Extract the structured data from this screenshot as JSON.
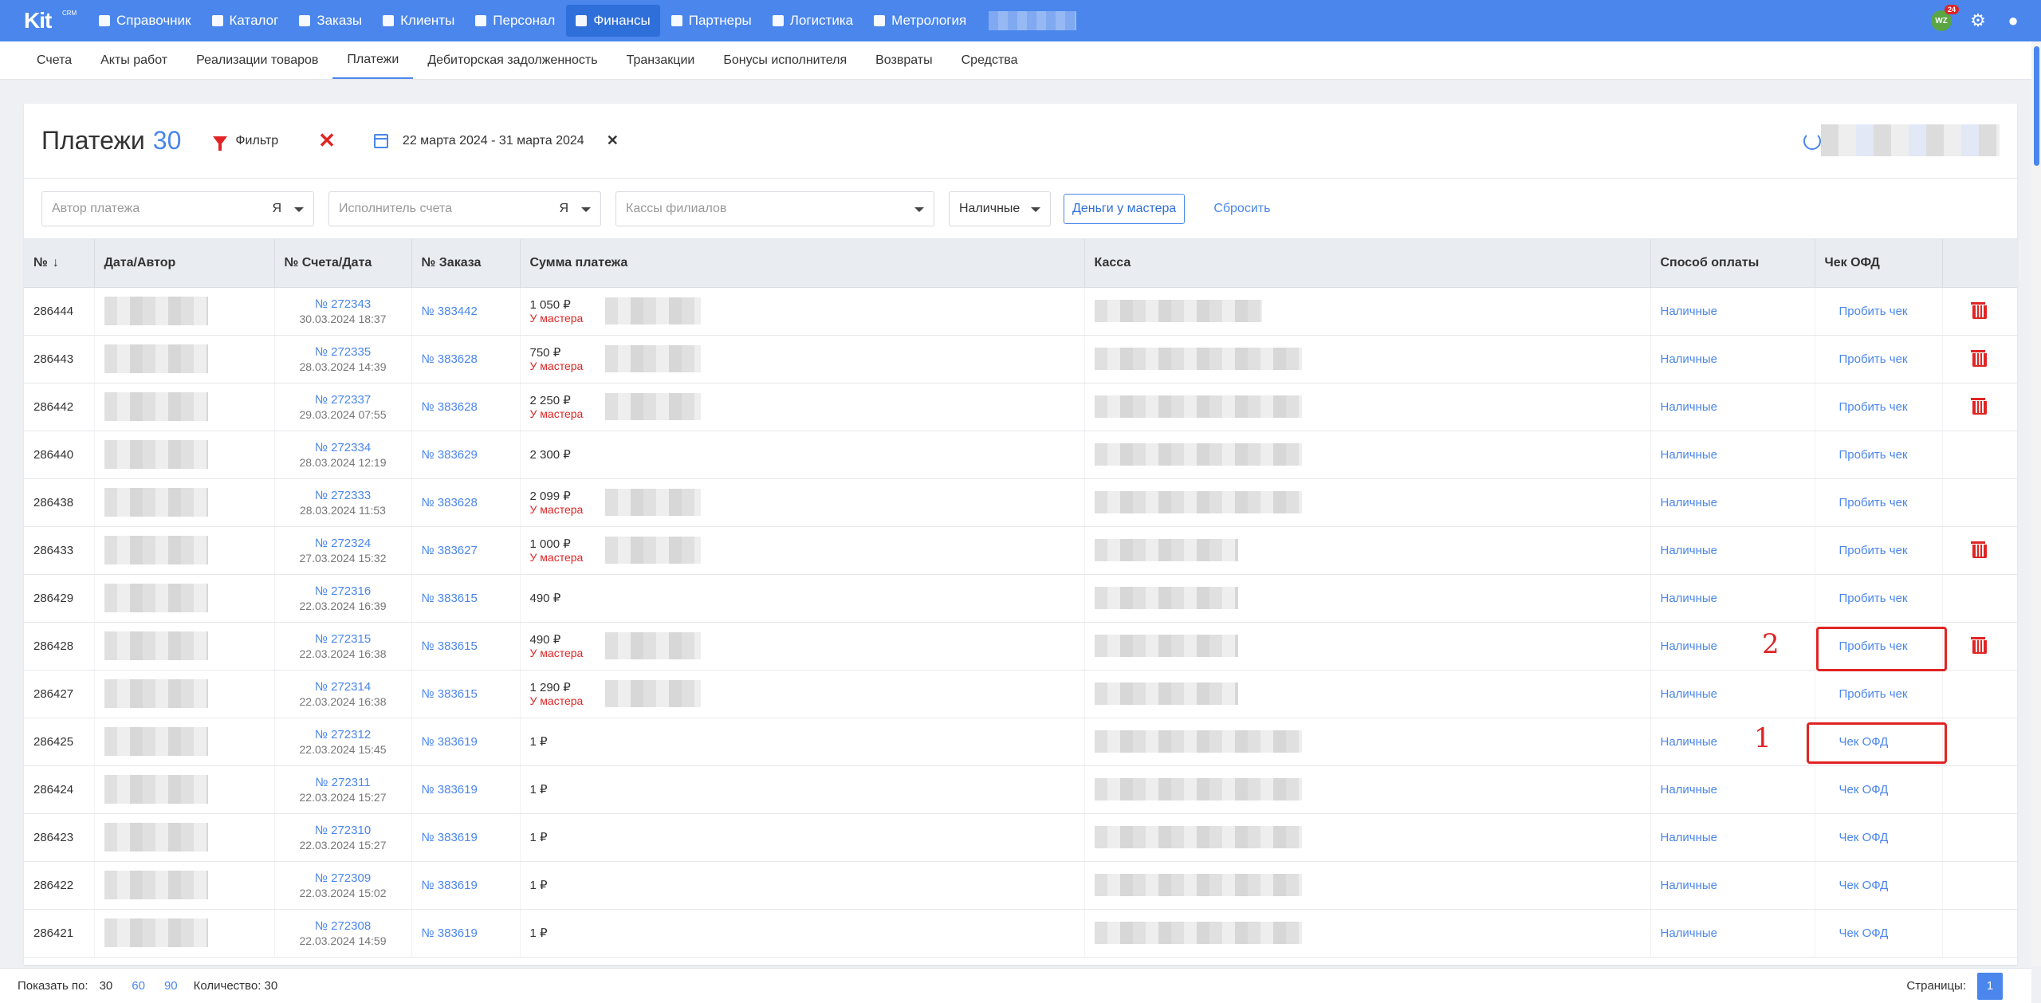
{
  "app": {
    "logo": "Kit",
    "logo_sup": "CRM"
  },
  "topnav": [
    {
      "label": "Справочник",
      "icon": "book-icon"
    },
    {
      "label": "Каталог",
      "icon": "catalog-icon"
    },
    {
      "label": "Заказы",
      "icon": "orders-icon"
    },
    {
      "label": "Клиенты",
      "icon": "clients-icon"
    },
    {
      "label": "Персонал",
      "icon": "staff-icon"
    },
    {
      "label": "Финансы",
      "icon": "finance-icon",
      "active": true
    },
    {
      "label": "Партнеры",
      "icon": "partners-icon"
    },
    {
      "label": "Логистика",
      "icon": "truck-icon"
    },
    {
      "label": "Метрология",
      "icon": "metrology-icon"
    }
  ],
  "user": {
    "initials": "WZ",
    "notifications": "24"
  },
  "subnav": [
    "Счета",
    "Акты работ",
    "Реализации товаров",
    "Платежи",
    "Дебиторская задолженность",
    "Транзакции",
    "Бонусы исполнителя",
    "Возвраты",
    "Средства"
  ],
  "subnav_active": "Платежи",
  "header": {
    "title": "Платежи",
    "count": "30",
    "filter_label": "Фильтр",
    "date_range": "22 марта 2024 - 31 марта 2024"
  },
  "filters": {
    "author_placeholder": "Автор платежа",
    "author_value": "Я",
    "executor_placeholder": "Исполнитель счета",
    "executor_value": "Я",
    "cash_placeholder": "Кассы филиалов",
    "payment_type": "Наличные",
    "master_money_btn": "Деньги у мастера",
    "reset": "Сбросить"
  },
  "table": {
    "columns": [
      "№",
      "Дата/Автор",
      "№ Счета/Дата",
      "№ Заказа",
      "Сумма платежа",
      "Касса",
      "Способ оплаты",
      "Чек ОФД",
      ""
    ],
    "rows": [
      {
        "id": "286444",
        "account": "№ 272343",
        "account_date": "30.03.2024 18:37",
        "order": "№ 383442",
        "amount": "1 050 ₽",
        "sub": "У мастера",
        "method": "Наличные",
        "ofd": "Пробить чек",
        "trash": true
      },
      {
        "id": "286443",
        "account": "№ 272335",
        "account_date": "28.03.2024 14:39",
        "order": "№ 383628",
        "amount": "750 ₽",
        "sub": "У мастера",
        "method": "Наличные",
        "ofd": "Пробить чек",
        "trash": true
      },
      {
        "id": "286442",
        "account": "№ 272337",
        "account_date": "29.03.2024 07:55",
        "order": "№ 383628",
        "amount": "2 250 ₽",
        "sub": "У мастера",
        "method": "Наличные",
        "ofd": "Пробить чек",
        "trash": true
      },
      {
        "id": "286440",
        "account": "№ 272334",
        "account_date": "28.03.2024 12:19",
        "order": "№ 383629",
        "amount": "2 300 ₽",
        "sub": "",
        "method": "Наличные",
        "ofd": "Пробить чек",
        "trash": false
      },
      {
        "id": "286438",
        "account": "№ 272333",
        "account_date": "28.03.2024 11:53",
        "order": "№ 383628",
        "amount": "2 099 ₽",
        "sub": "У мастера",
        "method": "Наличные",
        "ofd": "Пробить чек",
        "trash": false
      },
      {
        "id": "286433",
        "account": "№ 272324",
        "account_date": "27.03.2024 15:32",
        "order": "№ 383627",
        "amount": "1 000 ₽",
        "sub": "У мастера",
        "method": "Наличные",
        "ofd": "Пробить чек",
        "trash": true
      },
      {
        "id": "286429",
        "account": "№ 272316",
        "account_date": "22.03.2024 16:39",
        "order": "№ 383615",
        "amount": "490 ₽",
        "sub": "",
        "method": "Наличные",
        "ofd": "Пробить чек",
        "trash": false
      },
      {
        "id": "286428",
        "account": "№ 272315",
        "account_date": "22.03.2024 16:38",
        "order": "№ 383615",
        "amount": "490 ₽",
        "sub": "У мастера",
        "method": "Наличные",
        "ofd": "Пробить чек",
        "trash": true
      },
      {
        "id": "286427",
        "account": "№ 272314",
        "account_date": "22.03.2024 16:38",
        "order": "№ 383615",
        "amount": "1 290 ₽",
        "sub": "У мастера",
        "method": "Наличные",
        "ofd": "Пробить чек",
        "trash": false
      },
      {
        "id": "286425",
        "account": "№ 272312",
        "account_date": "22.03.2024 15:45",
        "order": "№ 383619",
        "amount": "1 ₽",
        "sub": "",
        "method": "Наличные",
        "ofd": "Чек ОФД",
        "trash": false
      },
      {
        "id": "286424",
        "account": "№ 272311",
        "account_date": "22.03.2024 15:27",
        "order": "№ 383619",
        "amount": "1 ₽",
        "sub": "",
        "method": "Наличные",
        "ofd": "Чек ОФД",
        "trash": false
      },
      {
        "id": "286423",
        "account": "№ 272310",
        "account_date": "22.03.2024 15:27",
        "order": "№ 383619",
        "amount": "1 ₽",
        "sub": "",
        "method": "Наличные",
        "ofd": "Чек ОФД",
        "trash": false
      },
      {
        "id": "286422",
        "account": "№ 272309",
        "account_date": "22.03.2024 15:02",
        "order": "№ 383619",
        "amount": "1 ₽",
        "sub": "",
        "method": "Наличные",
        "ofd": "Чек ОФД",
        "trash": false
      },
      {
        "id": "286421",
        "account": "№ 272308",
        "account_date": "22.03.2024 14:59",
        "order": "№ 383619",
        "amount": "1 ₽",
        "sub": "",
        "method": "Наличные",
        "ofd": "Чек ОФД",
        "trash": false
      }
    ]
  },
  "annotations": [
    {
      "label": "1"
    },
    {
      "label": "2"
    }
  ],
  "footer": {
    "show_label": "Показать по:",
    "sizes": [
      "30",
      "60",
      "90"
    ],
    "count_label": "Количество: 30",
    "pages_label": "Страницы:",
    "page": "1"
  }
}
